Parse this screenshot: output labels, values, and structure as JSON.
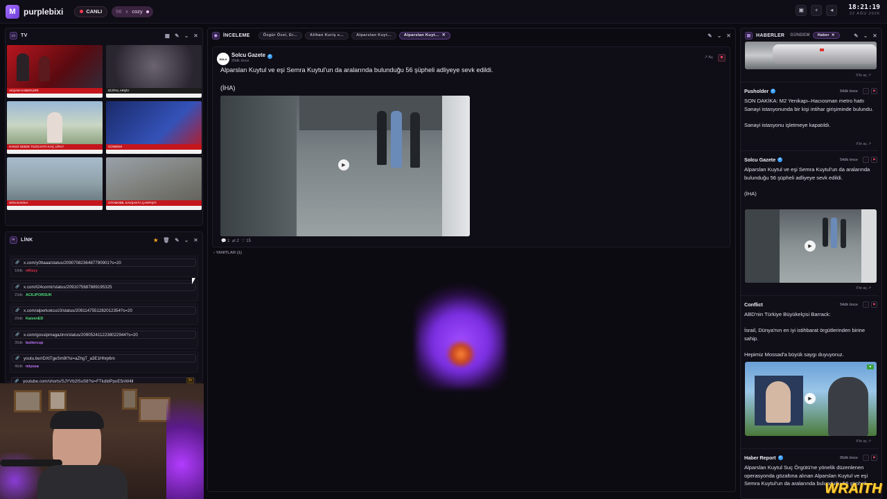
{
  "topbar": {
    "brand": "purplebixi",
    "live_label": "CANLI",
    "search_count": "56",
    "search_x": "x",
    "search_value": "cozy",
    "clock_time": "18:21:19",
    "clock_date": "22 AĞU 2026"
  },
  "tv_panel": {
    "title": "TV",
    "tickers": [
      "AKŞAM HABERLERİ",
      "DİJİTAL ARŞİV",
      "HANGİ SEBZE TEZGAHTA KAÇ LİRA?",
      "GÜNDEM",
      "SON DAKİKA",
      "OTOMOBİL KAVŞAKTA ÇARPIŞTI"
    ]
  },
  "link_panel": {
    "title": "LİNK",
    "items": [
      {
        "url": "x.com/y0ttaaa/status/2090708236487790901?s=20",
        "time": "18dk",
        "user": "nRizzy",
        "color": "#e0304a"
      },
      {
        "url": "x.com/t24comtr/status/2091075687889195325",
        "time": "23dk",
        "user": "ACILIPORSUK",
        "color": "#4ee07a"
      },
      {
        "url": "x.com/alperkokcu10/status/2091147551282012354?s=20",
        "time": "29dk",
        "user": "KaizenED",
        "color": "#4ee07a"
      },
      {
        "url": "x.com/gossipmagazinn/status/2090524112238022944?s=20",
        "time": "35dk",
        "user": "buttercup",
        "color": "#c277ff"
      },
      {
        "url": "youtu.be/rDXtTgeSm9l?si=aZhgT_a3E1Hhrp6m",
        "time": "46dk",
        "user": "miyusa",
        "color": "#c277ff"
      },
      {
        "url": "youtube.com/shorts/SJYVb2lSuS8?si=FTkdIdPpoE5nW4ll",
        "time": "",
        "user": "",
        "color": "#c277ff",
        "badge": "2x"
      }
    ]
  },
  "center": {
    "title": "İNCELEME",
    "tabs": [
      "Özgür Özel, Er...",
      "Alihan Kuriş s...",
      "Alparslan Kuyt...",
      "Alparslan Kuyt..."
    ],
    "post": {
      "avatar": "SOLO",
      "author": "Solcu Gazete",
      "time": "29dk önce",
      "open_label": "Aç",
      "text1": "Alparslan Kuytul ve eşi Semra Kuytul'un da aralarında bulunduğu 56 şüpheli adliyeye sevk edildi.",
      "text2": "(İHA)",
      "stats": {
        "replies": "1",
        "reposts": "2",
        "likes": "15"
      }
    },
    "replies_label": "YANITLAR (1)"
  },
  "news_panel": {
    "title": "HABERLER",
    "tab_gundem": "GÜNDEM",
    "tab_haber": "Haber",
    "open_label": "X'te aç",
    "items": [
      {
        "author": "Pusholder",
        "time": "54dk önce",
        "text": "SON DAKİKA: M2 Yenikapı–Hacıosman metro hattı Sanayi istasyonunda bir kişi intihar girişiminde bulundu.\n\nSanayi istasyonu işletmeye kapatıldı."
      },
      {
        "author": "Solcu Gazete",
        "time": "54dk önce",
        "text": "Alparslan Kuytul ve eşi Semra Kuytul'un da aralarında bulunduğu 56 şüpheli adliyeye sevk edildi.\n\n(İHA)"
      },
      {
        "author": "Conflict",
        "time": "54dk önce",
        "text": "ABD'nin Türkiye Büyükelçisi Barrack:\n\nİsrail, Dünya'nın en iyi istihbarat örgütlerinden birine sahip.\n\nHepimiz Mossad'a büyük saygı duyuyoruz."
      },
      {
        "author": "Haber Report",
        "time": "55dk önce",
        "text": "Alparslan Kuytul Suç Örgütü'ne yönelik düzenlenen operasyonda gözaltına alınan Alparslan Kuytul ve eşi Semra Kuytul'un da aralarında bulunduğu 56 şüpheli"
      }
    ]
  },
  "watermark": "WRAITH"
}
